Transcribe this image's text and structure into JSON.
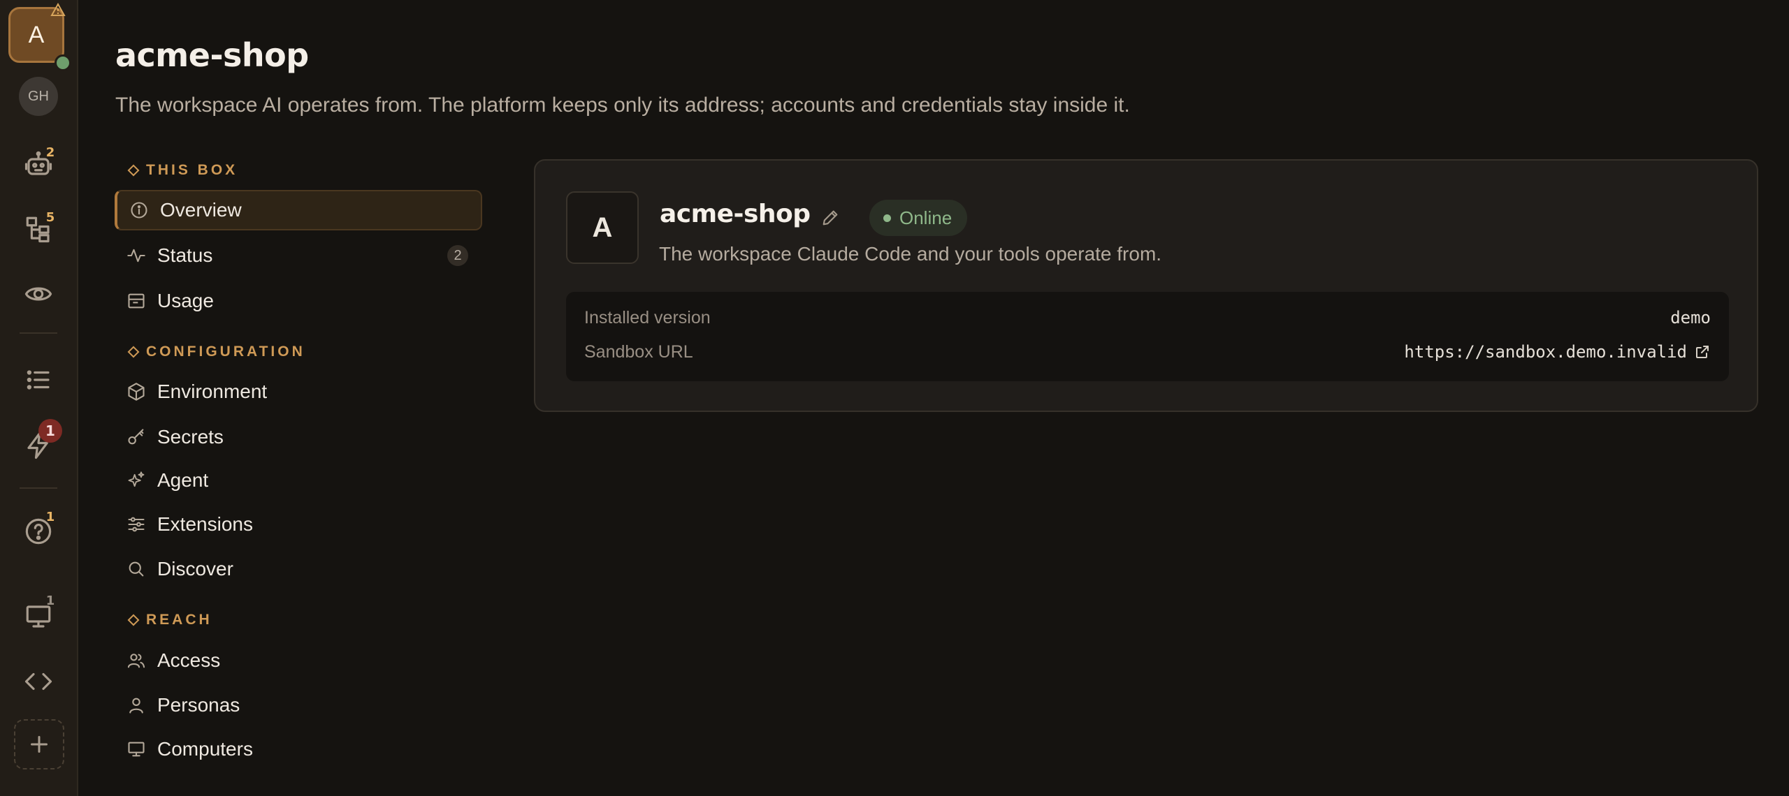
{
  "rail": {
    "workspace_initial": "A",
    "account_initials": "GH",
    "badges": {
      "agents": "2",
      "tree": "5",
      "activity": "1",
      "help": "1",
      "computers": "1"
    }
  },
  "header": {
    "title": "acme-shop",
    "subtitle": "The workspace AI operates from. The platform keeps only its address; accounts and credentials stay inside it."
  },
  "nav": {
    "sections": [
      {
        "title": "THIS BOX",
        "items": [
          {
            "label": "Overview",
            "icon": "info-icon"
          },
          {
            "label": "Status",
            "icon": "pulse-icon",
            "count": "2"
          },
          {
            "label": "Usage",
            "icon": "usage-icon"
          }
        ]
      },
      {
        "title": "CONFIGURATION",
        "items": [
          {
            "label": "Environment",
            "icon": "cube-icon"
          },
          {
            "label": "Secrets",
            "icon": "key-icon"
          },
          {
            "label": "Agent",
            "icon": "sparkles-icon"
          },
          {
            "label": "Extensions",
            "icon": "sliders-icon"
          },
          {
            "label": "Discover",
            "icon": "search-icon"
          }
        ]
      },
      {
        "title": "REACH",
        "items": [
          {
            "label": "Access",
            "icon": "users-icon"
          },
          {
            "label": "Personas",
            "icon": "user-icon"
          },
          {
            "label": "Computers",
            "icon": "monitor-icon"
          }
        ]
      }
    ]
  },
  "card": {
    "avatar": "A",
    "name": "acme-shop",
    "status": "Online",
    "description": "The workspace Claude Code and your tools operate from.",
    "rows": [
      {
        "label": "Installed version",
        "value": "demo"
      },
      {
        "label": "Sandbox URL",
        "value": "https://sandbox.demo.invalid"
      }
    ]
  },
  "colors": {
    "accent": "#cf9a56",
    "online": "#8fb88a",
    "background": "#151310",
    "rail": "#221d17"
  }
}
